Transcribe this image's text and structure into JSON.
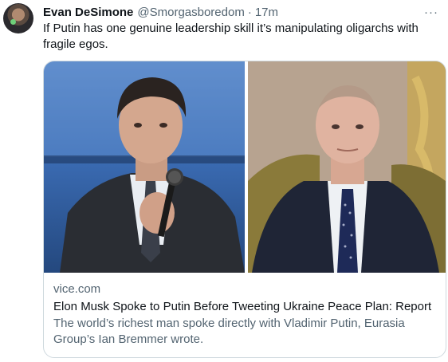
{
  "tweet": {
    "author": {
      "display_name": "Evan DeSimone",
      "handle": "@Smorgasboredom",
      "separator": "·",
      "time": "17m"
    },
    "more_icon": "···",
    "text": "If Putin has one genuine leadership skill it’s manipulating oligarchs with fragile egos."
  },
  "card": {
    "domain": "vice.com",
    "title": "Elon Musk Spoke to Putin Before Tweeting Ukraine Peace Plan: Report",
    "description": "The world’s richest man spoke directly with Vladimir Putin, Eurasia Group’s Ian Bremmer wrote."
  },
  "colors": {
    "primary_text": "#0f1419",
    "secondary_text": "#536471",
    "card_border": "#cfd9de"
  },
  "icons": {
    "more": "more-horizontal-icon"
  }
}
